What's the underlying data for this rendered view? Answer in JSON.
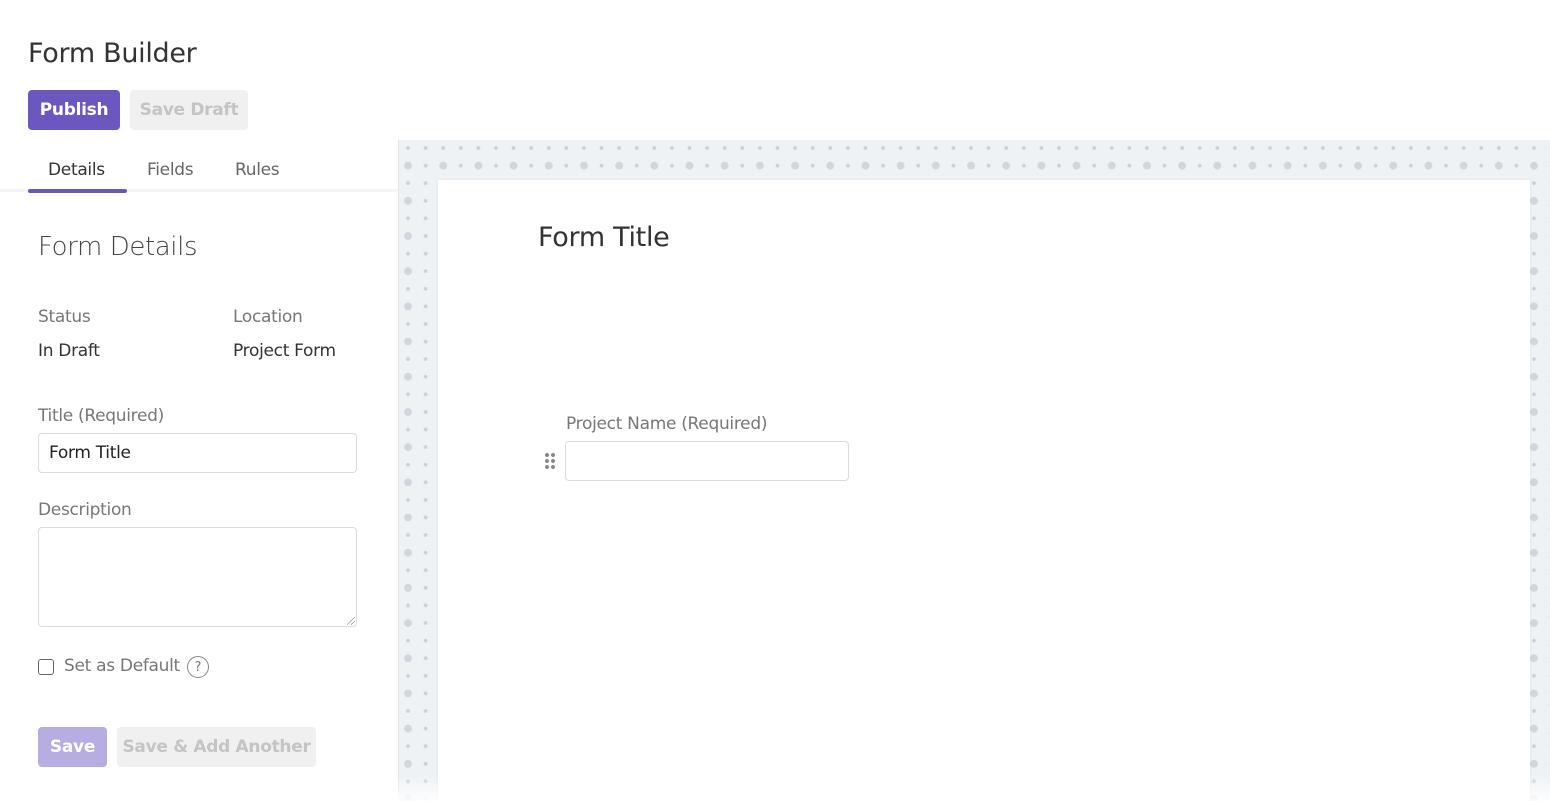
{
  "header": {
    "title": "Form Builder",
    "publish_label": "Publish",
    "save_draft_label": "Save Draft"
  },
  "tabs": [
    {
      "label": "Details",
      "active": true
    },
    {
      "label": "Fields",
      "active": false
    },
    {
      "label": "Rules",
      "active": false
    }
  ],
  "details": {
    "section_title": "Form Details",
    "status_label": "Status",
    "status_value": "In Draft",
    "location_label": "Location",
    "location_value": "Project Form",
    "title_label": "Title (Required)",
    "title_value": "Form Title",
    "description_label": "Description",
    "description_value": "",
    "set_default_label": "Set as Default",
    "set_default_checked": false,
    "help_icon": "?",
    "save_label": "Save",
    "save_add_label": "Save & Add Another"
  },
  "canvas": {
    "form_title": "Form Title",
    "fields": [
      {
        "label": "Project Name (Required)",
        "value": ""
      }
    ]
  },
  "colors": {
    "accent": "#6c56c0",
    "accent_disabled": "#b8ade0",
    "canvas_bg": "#eff2f5"
  }
}
